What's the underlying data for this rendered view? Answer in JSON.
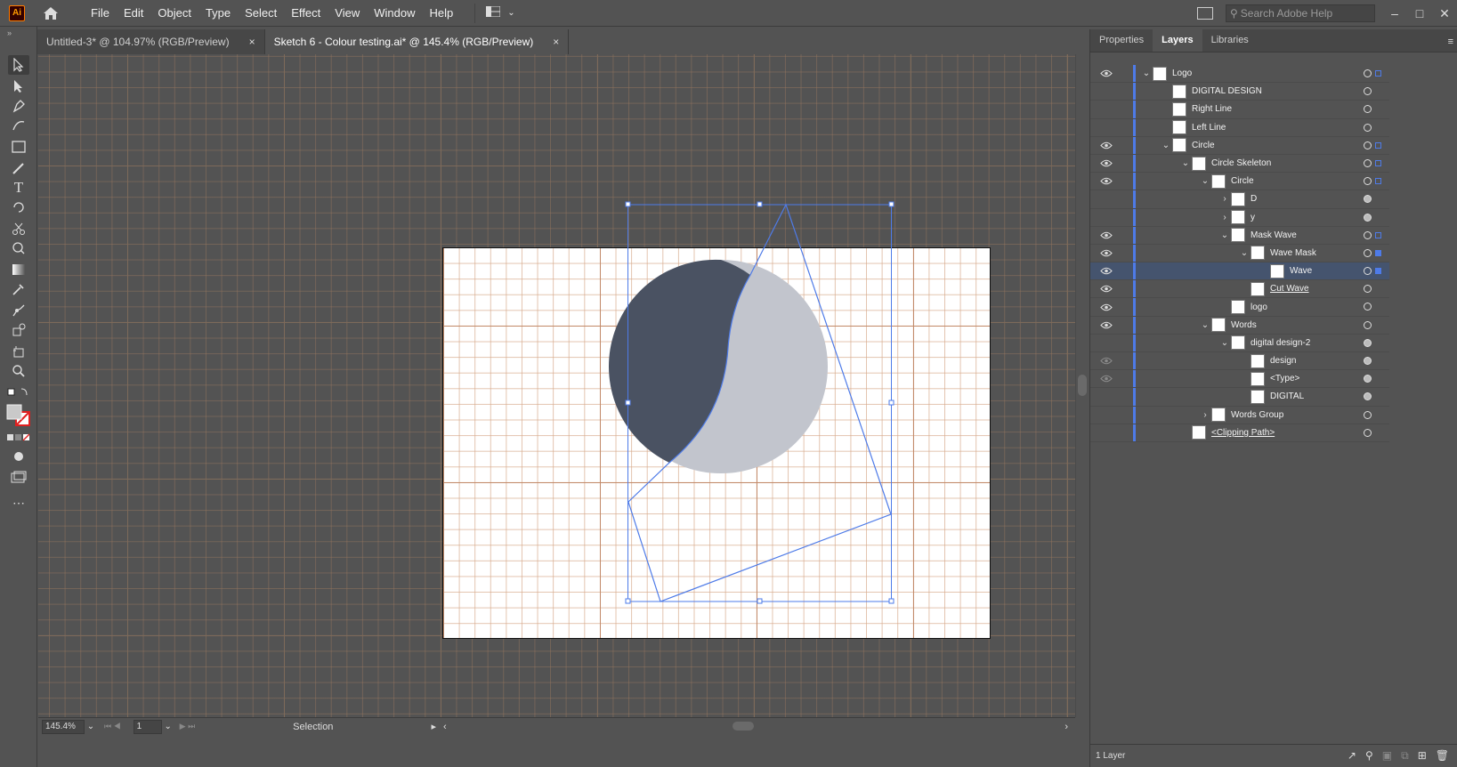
{
  "app": {
    "logo_text": "Ai"
  },
  "menu": [
    "File",
    "Edit",
    "Object",
    "Type",
    "Select",
    "Effect",
    "View",
    "Window",
    "Help"
  ],
  "search": {
    "placeholder": "Search Adobe Help"
  },
  "tabs": [
    {
      "label": "Untitled-3* @ 104.97% (RGB/Preview)",
      "active": false
    },
    {
      "label": "Sketch 6 - Colour testing.ai* @ 145.4% (RGB/Preview)",
      "active": true
    }
  ],
  "tab_close": "×",
  "colors": {
    "accent": "#4e7be8",
    "dark_half": "#4a5262",
    "light_half": "#c2c5cd",
    "artboard": "#ffffff",
    "canvas": "#535353"
  },
  "tools": [
    "selection-tool",
    "direct-selection-tool",
    "pen-tool",
    "curvature-tool",
    "rectangle-tool",
    "paintbrush-tool",
    "type-tool",
    "rotate-tool",
    "scissors-tool",
    "shape-builder-tool",
    "gradient-tool",
    "eyedropper-tool",
    "blend-tool",
    "symbol-sprayer-tool",
    "artboard-tool",
    "zoom-tool"
  ],
  "status": {
    "zoom": "145.4%",
    "page": "1",
    "mode": "Selection"
  },
  "panel": {
    "tabs": [
      "Properties",
      "Layers",
      "Libraries"
    ],
    "active_tab": "Layers",
    "footer": "1 Layer"
  },
  "layers": [
    {
      "name": "Logo",
      "level": 0,
      "chev": "down",
      "eye": true,
      "target_filled": false,
      "sel": "empty"
    },
    {
      "name": "DIGITAL DESIGN",
      "level": 1,
      "chev": "",
      "eye": false,
      "target_filled": false,
      "sel": ""
    },
    {
      "name": "Right Line",
      "level": 1,
      "chev": "",
      "eye": false,
      "target_filled": false,
      "sel": ""
    },
    {
      "name": "Left Line",
      "level": 1,
      "chev": "",
      "eye": false,
      "target_filled": false,
      "sel": ""
    },
    {
      "name": "Circle",
      "level": 1,
      "chev": "down",
      "eye": true,
      "target_filled": false,
      "sel": "empty"
    },
    {
      "name": "Circle Skeleton",
      "level": 2,
      "chev": "down",
      "eye": true,
      "target_filled": false,
      "sel": "empty"
    },
    {
      "name": "Circle",
      "level": 3,
      "chev": "down",
      "eye": true,
      "target_filled": false,
      "sel": "empty"
    },
    {
      "name": "D",
      "level": 4,
      "chev": "right",
      "eye": false,
      "target_filled": true,
      "sel": ""
    },
    {
      "name": "y",
      "level": 4,
      "chev": "right",
      "eye": false,
      "target_filled": true,
      "sel": ""
    },
    {
      "name": "Mask Wave",
      "level": 4,
      "chev": "down",
      "eye": true,
      "target_filled": false,
      "sel": "empty"
    },
    {
      "name": "Wave Mask",
      "level": 5,
      "chev": "down",
      "eye": true,
      "target_filled": false,
      "sel": "filled"
    },
    {
      "name": "Wave",
      "level": 6,
      "chev": "",
      "eye": true,
      "target_filled": false,
      "sel": "filled",
      "selected": true
    },
    {
      "name": "Cut Wave",
      "level": 5,
      "chev": "",
      "eye": true,
      "target_filled": false,
      "sel": "",
      "underline": true
    },
    {
      "name": "logo",
      "level": 4,
      "chev": "",
      "eye": true,
      "target_filled": false,
      "sel": ""
    },
    {
      "name": "Words",
      "level": 3,
      "chev": "down",
      "eye": true,
      "target_filled": false,
      "sel": ""
    },
    {
      "name": "digital design-2",
      "level": 4,
      "chev": "down",
      "eye": false,
      "target_filled": true,
      "sel": ""
    },
    {
      "name": "design",
      "level": 5,
      "chev": "",
      "eye": "dim",
      "target_filled": true,
      "sel": ""
    },
    {
      "name": "<Type>",
      "level": 5,
      "chev": "",
      "eye": "dim",
      "target_filled": true,
      "sel": ""
    },
    {
      "name": "DIGITAL",
      "level": 5,
      "chev": "",
      "eye": false,
      "target_filled": true,
      "sel": ""
    },
    {
      "name": "Words Group",
      "level": 3,
      "chev": "right",
      "eye": false,
      "target_filled": false,
      "sel": ""
    },
    {
      "name": "<Clipping Path>",
      "level": 2,
      "chev": "",
      "eye": false,
      "target_filled": false,
      "sel": "",
      "underline": true
    }
  ]
}
